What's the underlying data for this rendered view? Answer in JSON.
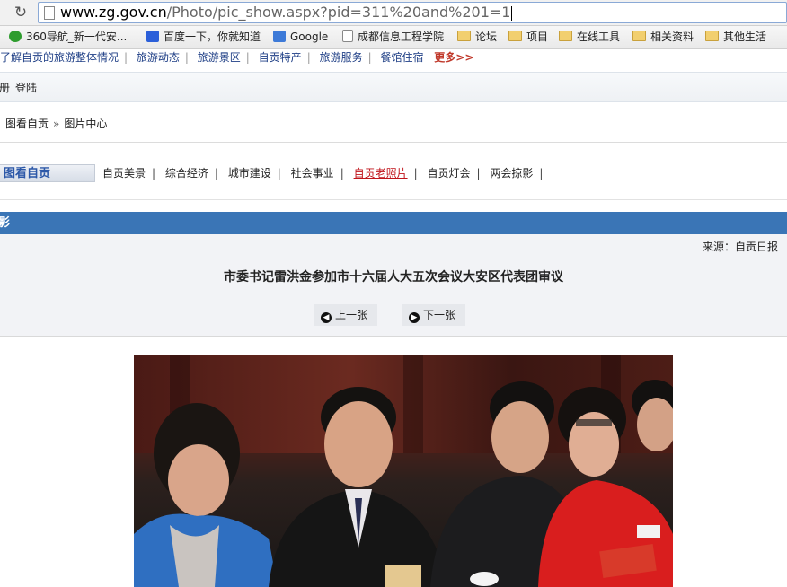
{
  "browser": {
    "url_host": "www.zg.gov.cn",
    "url_path": "/Photo/pic_show.aspx?pid=311%20and%201=1",
    "bookmarks": [
      {
        "label": "360导航_新一代安...",
        "icon": "360-icon"
      },
      {
        "label": "百度一下，你就知道",
        "icon": "baidu-icon"
      },
      {
        "label": "Google",
        "icon": "google-icon"
      },
      {
        "label": "成都信息工程学院",
        "icon": "page-icon"
      },
      {
        "label": "论坛",
        "icon": "folder-icon"
      },
      {
        "label": "项目",
        "icon": "folder-icon"
      },
      {
        "label": "在线工具",
        "icon": "folder-icon"
      },
      {
        "label": "相关资料",
        "icon": "folder-icon"
      },
      {
        "label": "其他生活",
        "icon": "folder-icon"
      }
    ]
  },
  "site": {
    "toplinks": [
      "了解自贡的旅游整体情况",
      "旅游动态",
      "旅游景区",
      "自贡特产",
      "旅游服务",
      "餐馆住宿"
    ],
    "more_label": "更多>>",
    "register_label": "册",
    "login_label": "登陆",
    "breadcrumb": [
      "图看自贡",
      "图片中心"
    ],
    "breadcrumb_sep": "»",
    "category_title": "图看自贡",
    "categories": [
      {
        "label": "自贡美景",
        "active": false
      },
      {
        "label": "综合经济",
        "active": false
      },
      {
        "label": "城市建设",
        "active": false
      },
      {
        "label": "社会事业",
        "active": false
      },
      {
        "label": "自贡老照片",
        "active": true
      },
      {
        "label": "自贡灯会",
        "active": false
      },
      {
        "label": "两会掠影",
        "active": false
      }
    ],
    "section_header": "影",
    "source": "来源：自贡日报",
    "photo_title": "市委书记雷洪金参加市十六届人大五次会议大安区代表团审议",
    "prev_label": "上一张",
    "next_label": "下一张"
  },
  "colors": {
    "header_blue": "#3a75b6",
    "active_category": "#c0141b",
    "link_blue": "#1f3f86"
  }
}
